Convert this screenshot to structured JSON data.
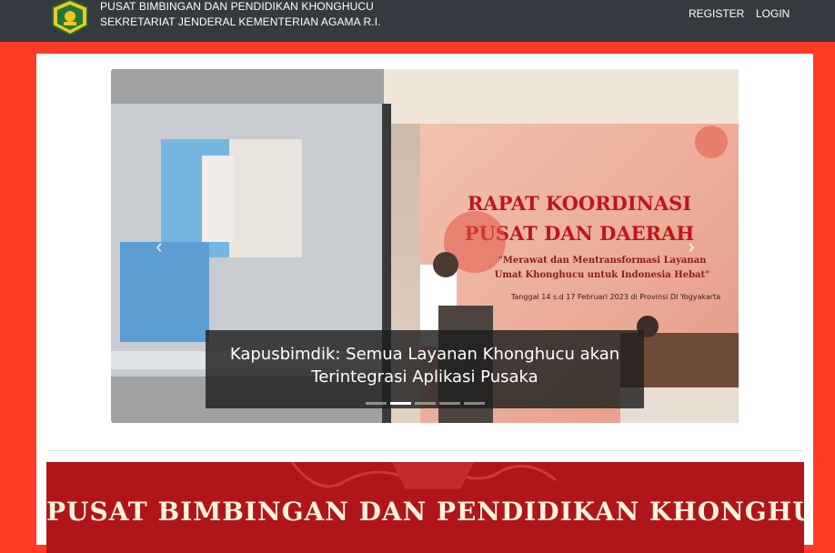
{
  "header": {
    "org_line_1": "PUSAT BIMBINGAN DAN PENDIDIKAN KHONGHUCU",
    "org_line_2": "SEKRETARIAT JENDERAL KEMENTERIAN AGAMA R.I.",
    "nav": {
      "register": "REGISTER",
      "login": "LOGIN"
    },
    "logo_icon": "kemenag-emblem-icon"
  },
  "carousel": {
    "caption": "Kapusbimdik: Semua Layanan Khonghucu akan Terintegrasi Aplikasi Pusaka",
    "slide_count": 5,
    "active_index": 1,
    "photo_banner": {
      "title_line_1": "RAPAT KOORDINASI",
      "title_line_2": "PUSAT DAN DAERAH",
      "tagline_1": "\"Merawat dan Mentransformasi Layanan",
      "tagline_2": "Umat Khonghucu untuk Indonesia Hebat\"",
      "date_line": "Tanggal 14 s.d 17 Februari 2023 di Provinsi DI Yogyakarta"
    },
    "prev_icon": "chevron-left-icon",
    "next_icon": "chevron-right-icon"
  },
  "section_banner": {
    "title": "PUSAT BIMBINGAN DAN PENDIDIKAN KHONGHUCU"
  },
  "colors": {
    "page_bg": "#ff3b26",
    "topbar": "#343a40",
    "banner": "#b0151a"
  }
}
